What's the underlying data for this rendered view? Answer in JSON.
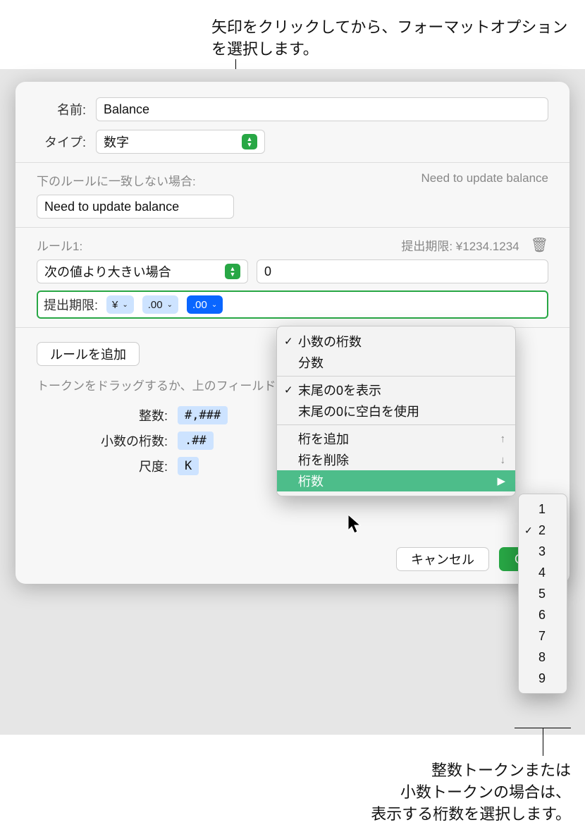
{
  "callouts": {
    "top": "矢印をクリックしてから、フォーマットオプションを選択します。",
    "bottom": "整数トークンまたは\n小数トークンの場合は、\n表示する桁数を選択します。"
  },
  "form": {
    "name_label": "名前:",
    "name_value": "Balance",
    "type_label": "タイプ:",
    "type_value": "数字",
    "no_match_label": "下のルールに一致しない場合:",
    "no_match_right": "Need to update balance",
    "no_match_value": "Need to update balance"
  },
  "rule": {
    "title": "ルール1:",
    "preview_label": "提出期限: ¥1234.1234",
    "condition": "次の値より大きい場合",
    "value": "0",
    "token_row_label": "提出期限:",
    "pill_currency": "¥",
    "pill_dec1": ".00",
    "pill_dec2": ".00"
  },
  "buttons": {
    "add_rule": "ルールを追加",
    "cancel": "キャンセル",
    "ok": "OK"
  },
  "drag_hint": "トークンをドラッグするか、上のフィールド",
  "tokens": {
    "int_label": "整数:",
    "int_value": "#,###",
    "dec_label": "小数の桁数:",
    "dec_value": ".##",
    "scale_label": "尺度:",
    "scale_value": "K"
  },
  "menu": {
    "items": [
      "小数の桁数",
      "分数"
    ],
    "items2": [
      "末尾の0を表示",
      "末尾の0に空白を使用"
    ],
    "add": "桁を追加",
    "remove": "桁を削除",
    "digits": "桁数",
    "checked": [
      0,
      2
    ]
  },
  "submenu": {
    "values": [
      "1",
      "2",
      "3",
      "4",
      "5",
      "6",
      "7",
      "8",
      "9"
    ],
    "checked_index": 1
  }
}
